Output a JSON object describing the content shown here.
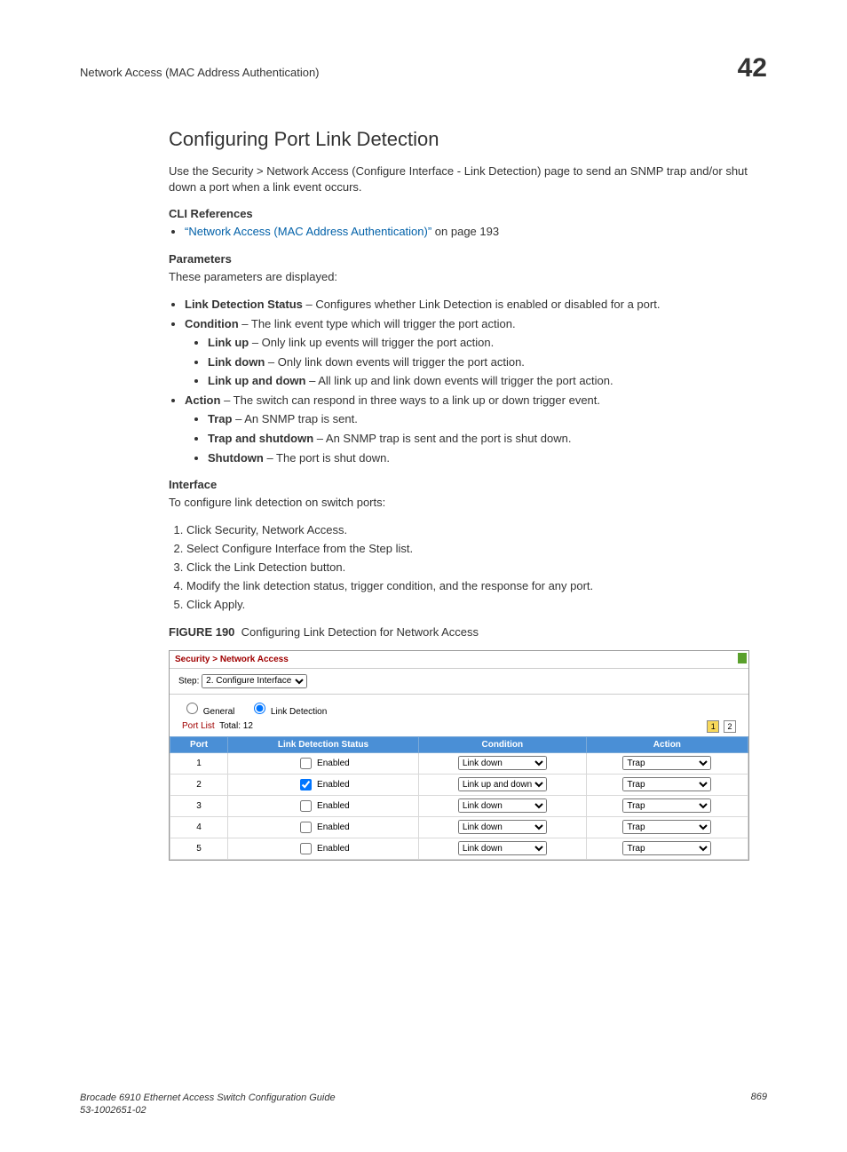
{
  "header": {
    "running_head": "Network Access (MAC Address Authentication)",
    "chapter_number": "42"
  },
  "section_title": "Configuring Port Link Detection",
  "intro": "Use the Security > Network Access (Configure Interface - Link Detection) page to send an SNMP trap and/or shut down a port when a link event occurs.",
  "cli_refs": {
    "heading": "CLI References",
    "link_text": "“Network Access (MAC Address Authentication)”",
    "link_suffix": " on page 193"
  },
  "params": {
    "heading": "Parameters",
    "intro": "These parameters are displayed:",
    "items": [
      {
        "term": "Link Detection Status",
        "desc": " – Configures whether Link Detection is enabled or disabled for a port."
      },
      {
        "term": "Condition",
        "desc": " – The link event type which will trigger the port action.",
        "sub": [
          {
            "term": "Link up",
            "desc": " – Only link up events will trigger the port action."
          },
          {
            "term": "Link down",
            "desc": " – Only link down events will trigger the port action."
          },
          {
            "term": "Link up and down",
            "desc": " – All link up and link down events will trigger the port action."
          }
        ]
      },
      {
        "term": "Action",
        "desc": " – The switch can respond in three ways to a link up or down trigger event.",
        "sub": [
          {
            "term": "Trap",
            "desc": " – An SNMP trap is sent."
          },
          {
            "term": "Trap and shutdown",
            "desc": " – An SNMP trap is sent and the port is shut down."
          },
          {
            "term": "Shutdown",
            "desc": " – The port is shut down."
          }
        ]
      }
    ]
  },
  "interface": {
    "heading": "Interface",
    "intro": "To configure link detection on switch ports:",
    "steps": [
      "Click Security, Network Access.",
      "Select Configure Interface from the Step list.",
      "Click the Link Detection button.",
      "Modify the link detection status, trigger condition, and the response for any port.",
      "Click Apply."
    ]
  },
  "figure": {
    "label": "FIGURE 190",
    "caption": "Configuring Link Detection for Network Access"
  },
  "ui": {
    "breadcrumb": "Security > Network Access",
    "step_label": "Step:",
    "step_value": "2. Configure Interface",
    "radio_general": "General",
    "radio_linkdet": "Link Detection",
    "portlist_label": "Port List",
    "portlist_total_label": "Total:",
    "portlist_total": "12",
    "page1": "1",
    "page2": "2",
    "columns": {
      "port": "Port",
      "status": "Link Detection Status",
      "condition": "Condition",
      "action": "Action"
    },
    "enabled_label": "Enabled",
    "rows": [
      {
        "port": "1",
        "checked": false,
        "condition": "Link down",
        "action": "Trap"
      },
      {
        "port": "2",
        "checked": true,
        "condition": "Link up and down",
        "action": "Trap"
      },
      {
        "port": "3",
        "checked": false,
        "condition": "Link down",
        "action": "Trap"
      },
      {
        "port": "4",
        "checked": false,
        "condition": "Link down",
        "action": "Trap"
      },
      {
        "port": "5",
        "checked": false,
        "condition": "Link down",
        "action": "Trap"
      }
    ]
  },
  "footer": {
    "guide": "Brocade 6910 Ethernet Access Switch Configuration Guide",
    "docnum": "53-1002651-02",
    "pagenum": "869"
  }
}
